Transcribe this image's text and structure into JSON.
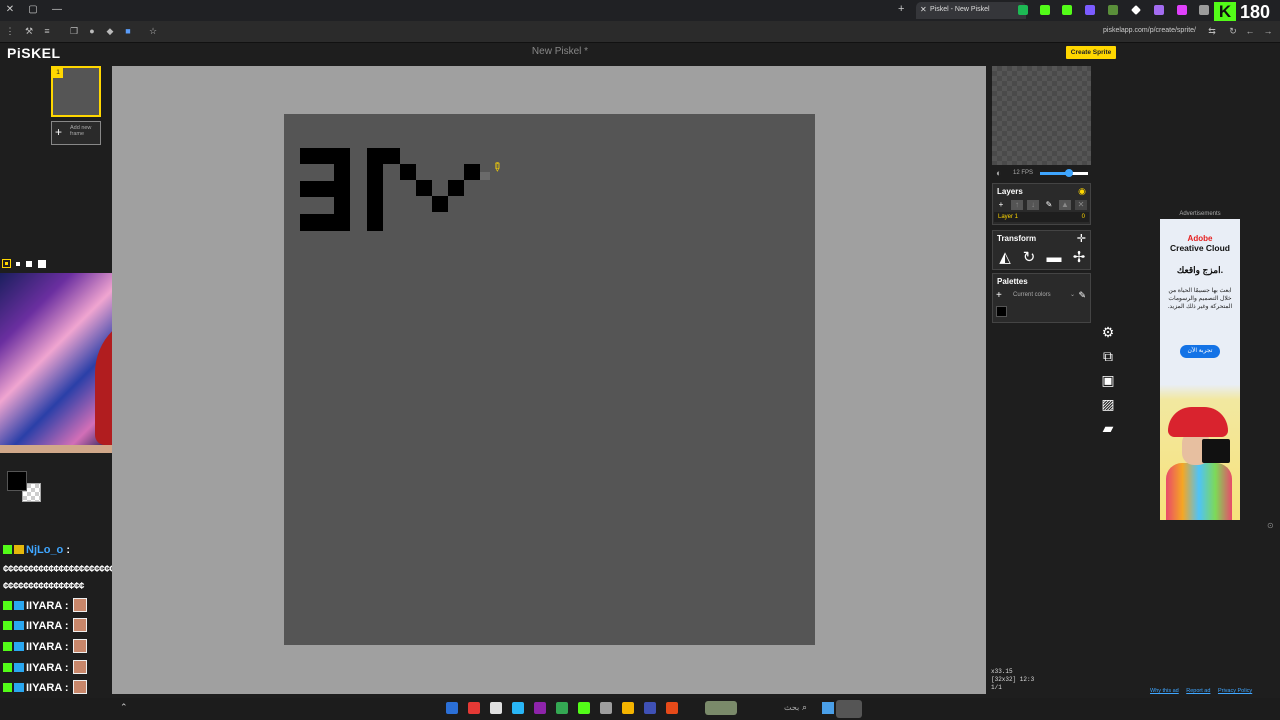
{
  "browser": {
    "tab_title": "Piskel - New Piskel",
    "tab_close": "✕",
    "new_tab": "+",
    "url": "piskelapp.com/p/create/sprite/",
    "window_buttons": [
      "✕",
      "▢",
      "—"
    ],
    "extension_colors": [
      "#1db954",
      "#53fc18",
      "#53fc18",
      "#7b5cff",
      "#5a8f3a",
      "#ffffff",
      "#a36cf0",
      "#e040fb",
      "#9b9b9b"
    ]
  },
  "stream": {
    "kick_badge": "K",
    "viewer_count": "180"
  },
  "app": {
    "logo": "PiSKEL",
    "sprite_name": "New Piskel *",
    "create_sprite": "Create Sprite"
  },
  "frames": {
    "frame_number": "1",
    "add_new_frame": "Add new frame"
  },
  "layers": {
    "title": "Layers",
    "layer_name": "Layer 1",
    "layer_opacity": "0"
  },
  "transform": {
    "title": "Transform"
  },
  "palettes": {
    "title": "Palettes",
    "selected": "Current colors"
  },
  "preview": {
    "fps": "12 FPS",
    "fps_level": 0.6
  },
  "status": {
    "cursor": "x33.15",
    "size": "[32x32] 12:3",
    "frame": "1/1"
  },
  "ad": {
    "label": "Advertisements",
    "brand_line1": "Adobe",
    "brand_line2": "Creative Cloud",
    "headline": "امزج واقعك.",
    "body": "ابعث بها جسيمًا الحياة من خلال التصميم والرسومات المتحركة وغير ذلك المزيد.",
    "cta": "تجربة الآن",
    "links": [
      "Why this ad",
      "Report ad",
      "Privacy Policy"
    ]
  },
  "chat": {
    "lines": [
      {
        "user": "NjLo_o",
        "suffix": " :",
        "message": "",
        "color": "blue"
      },
      {
        "user": "",
        "suffix": "",
        "message": "¢¢¢¢¢¢¢¢¢¢¢¢¢¢¢¢¢¢¢¢¢¢¢¢¢¢¢¢¢¢¢¢¢¢¢¢¢¢¢¢¢¢¢¢¢¢¢¢",
        "color": "white"
      },
      {
        "user": "",
        "suffix": "",
        "message": "¢¢¢¢¢¢¢¢¢¢¢¢¢¢¢¢",
        "color": "white"
      },
      {
        "user": "IIYARA",
        "suffix": " :",
        "message": "",
        "color": "white"
      },
      {
        "user": "IIYARA",
        "suffix": " :",
        "message": "",
        "color": "white"
      },
      {
        "user": "IIYARA",
        "suffix": " :",
        "message": "",
        "color": "white"
      },
      {
        "user": "IIYARA",
        "suffix": " :",
        "message": "",
        "color": "white"
      },
      {
        "user": "IIYARA",
        "suffix": " :",
        "message": "",
        "color": "white"
      },
      {
        "user": "IIYARA",
        "suffix": " :",
        "message": "",
        "color": "white"
      }
    ]
  },
  "taskbar": {
    "search_hint": "بحث",
    "app_colors": [
      "#2b6fd6",
      "#e53935",
      "#e0e0e0",
      "#29b6f6",
      "#8e24aa",
      "#34a853",
      "#53fc18",
      "#9e9e9e",
      "#f4b400",
      "#3f51b5",
      "#e64a19",
      "#cfd8dc",
      "#4caf50",
      "#1e88e5"
    ]
  }
}
